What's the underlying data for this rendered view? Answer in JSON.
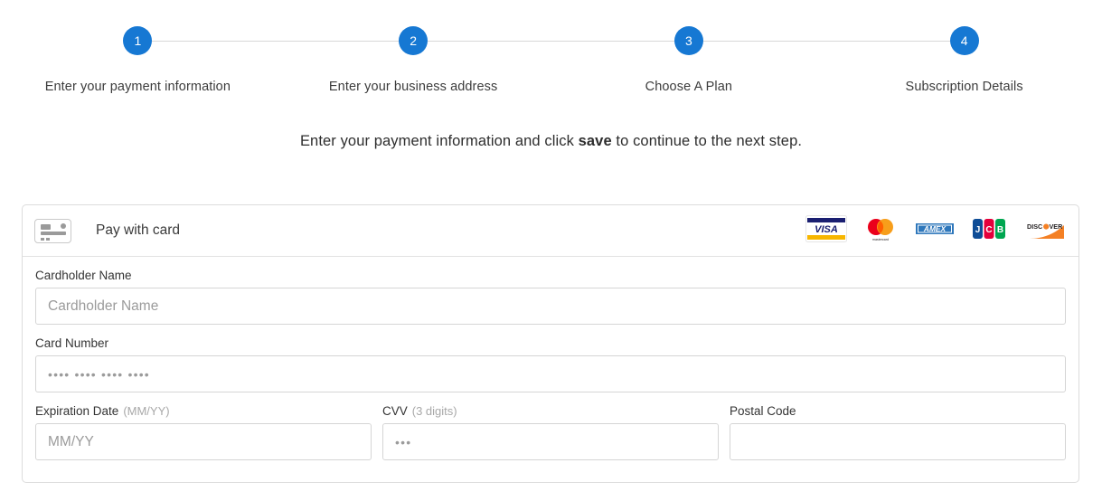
{
  "stepper": {
    "steps": [
      {
        "number": "1",
        "label": "Enter your payment information"
      },
      {
        "number": "2",
        "label": "Enter your business address"
      },
      {
        "number": "3",
        "label": "Choose A Plan"
      },
      {
        "number": "4",
        "label": "Subscription Details"
      }
    ],
    "active_color": "#1678d3",
    "connector_color": "#d8d8d8"
  },
  "instruction": {
    "prefix": "Enter your payment information and click ",
    "emphasis": "save",
    "suffix": " to continue to the next step."
  },
  "payment_panel": {
    "header": {
      "icon": "credit-card-icon",
      "title": "Pay with card",
      "brands": [
        {
          "name": "visa",
          "label": "VISA",
          "colors": {
            "band": "#1a1f71",
            "accent": "#f7b600"
          }
        },
        {
          "name": "mastercard",
          "label": "mastercard",
          "colors": {
            "left": "#eb001b",
            "right": "#f79e1b",
            "overlap": "#ff5f00"
          }
        },
        {
          "name": "amex",
          "label": "AMEX",
          "colors": {
            "bg": "#2e77bb",
            "text": "#ffffff"
          }
        },
        {
          "name": "jcb",
          "label": "JCB",
          "colors": {
            "j": "#0e4c96",
            "c": "#e4003b",
            "b": "#00a650"
          }
        },
        {
          "name": "discover",
          "label": "DISCOVER",
          "colors": {
            "text": "#231f20",
            "accent": "#f48024"
          }
        }
      ]
    },
    "fields": {
      "cardholder_name": {
        "label": "Cardholder Name",
        "placeholder": "Cardholder Name",
        "value": ""
      },
      "card_number": {
        "label": "Card Number",
        "placeholder": "•••• •••• •••• ••••",
        "value": ""
      },
      "expiration_date": {
        "label": "Expiration Date",
        "hint": "(MM/YY)",
        "placeholder": "MM/YY",
        "value": ""
      },
      "cvv": {
        "label": "CVV",
        "hint": "(3 digits)",
        "placeholder": "•••",
        "value": ""
      },
      "postal_code": {
        "label": "Postal Code",
        "hint": "",
        "placeholder": "",
        "value": ""
      }
    }
  }
}
